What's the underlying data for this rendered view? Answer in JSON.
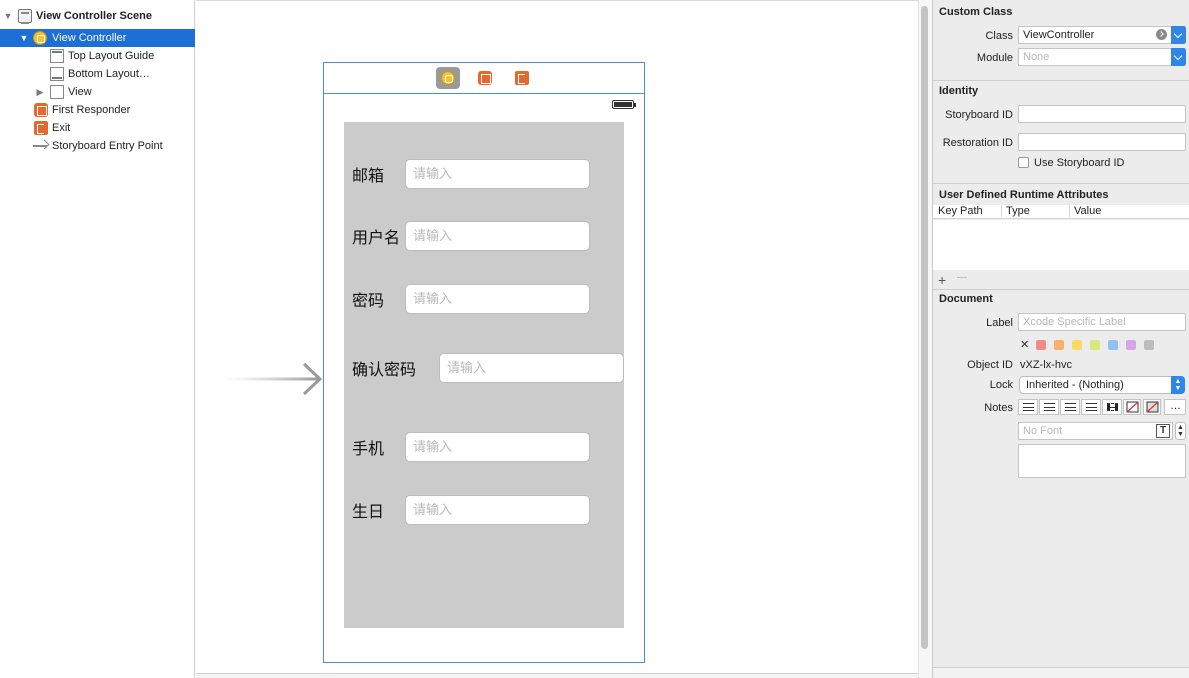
{
  "outline": {
    "items": [
      {
        "label": "View Controller Scene",
        "icon": "scene-icon",
        "disclosure": "expanded"
      },
      {
        "label": "View Controller",
        "icon": "view-controller-icon",
        "disclosure": "expanded",
        "selected": true
      },
      {
        "label": "Top Layout Guide",
        "icon": "layout-guide-icon"
      },
      {
        "label": "Bottom Layout…",
        "icon": "layout-guide-icon"
      },
      {
        "label": "View",
        "icon": "view-icon",
        "disclosure": "collapsed"
      },
      {
        "label": "First Responder",
        "icon": "first-responder-icon"
      },
      {
        "label": "Exit",
        "icon": "exit-icon"
      },
      {
        "label": "Storyboard Entry Point",
        "icon": "entry-point-arrow-icon"
      }
    ]
  },
  "scene": {
    "dock_icons": [
      "view-controller-icon",
      "first-responder-icon",
      "exit-icon"
    ],
    "form": [
      {
        "label": "邮箱",
        "placeholder": "请输入"
      },
      {
        "label": "用户名",
        "placeholder": "请输入"
      },
      {
        "label": "密码",
        "placeholder": "请输入"
      },
      {
        "label": "确认密码",
        "placeholder": "请输入"
      },
      {
        "label": "手机",
        "placeholder": "请输入"
      },
      {
        "label": "生日",
        "placeholder": "请输入"
      }
    ]
  },
  "inspector": {
    "custom_class": {
      "title": "Custom Class",
      "class_label": "Class",
      "class_value": "ViewController",
      "module_label": "Module",
      "module_placeholder": "None"
    },
    "identity": {
      "title": "Identity",
      "storyboard_id_label": "Storyboard ID",
      "restoration_id_label": "Restoration ID",
      "use_storyboard_id_label": "Use Storyboard ID"
    },
    "runtime_attributes": {
      "title": "User Defined Runtime Attributes",
      "columns": [
        "Key Path",
        "Type",
        "Value"
      ],
      "add_symbol": "+",
      "remove_symbol": "—"
    },
    "document": {
      "title": "Document",
      "label_label": "Label",
      "label_placeholder": "Xcode Specific Label",
      "clear_symbol": "✕",
      "label_colors": [
        "#f28b82",
        "#f6b26b",
        "#ffd966",
        "#d9ea7a",
        "#8fc1f5",
        "#d5a6e8",
        "#bdbdbd"
      ],
      "object_id_label": "Object ID",
      "object_id_value": "vXZ-lx-hvc",
      "lock_label": "Lock",
      "lock_value": "Inherited - (Nothing)",
      "notes_label": "Notes",
      "font_placeholder": "No Font",
      "font_icon_glyph": "T",
      "more_symbol": "…"
    }
  }
}
